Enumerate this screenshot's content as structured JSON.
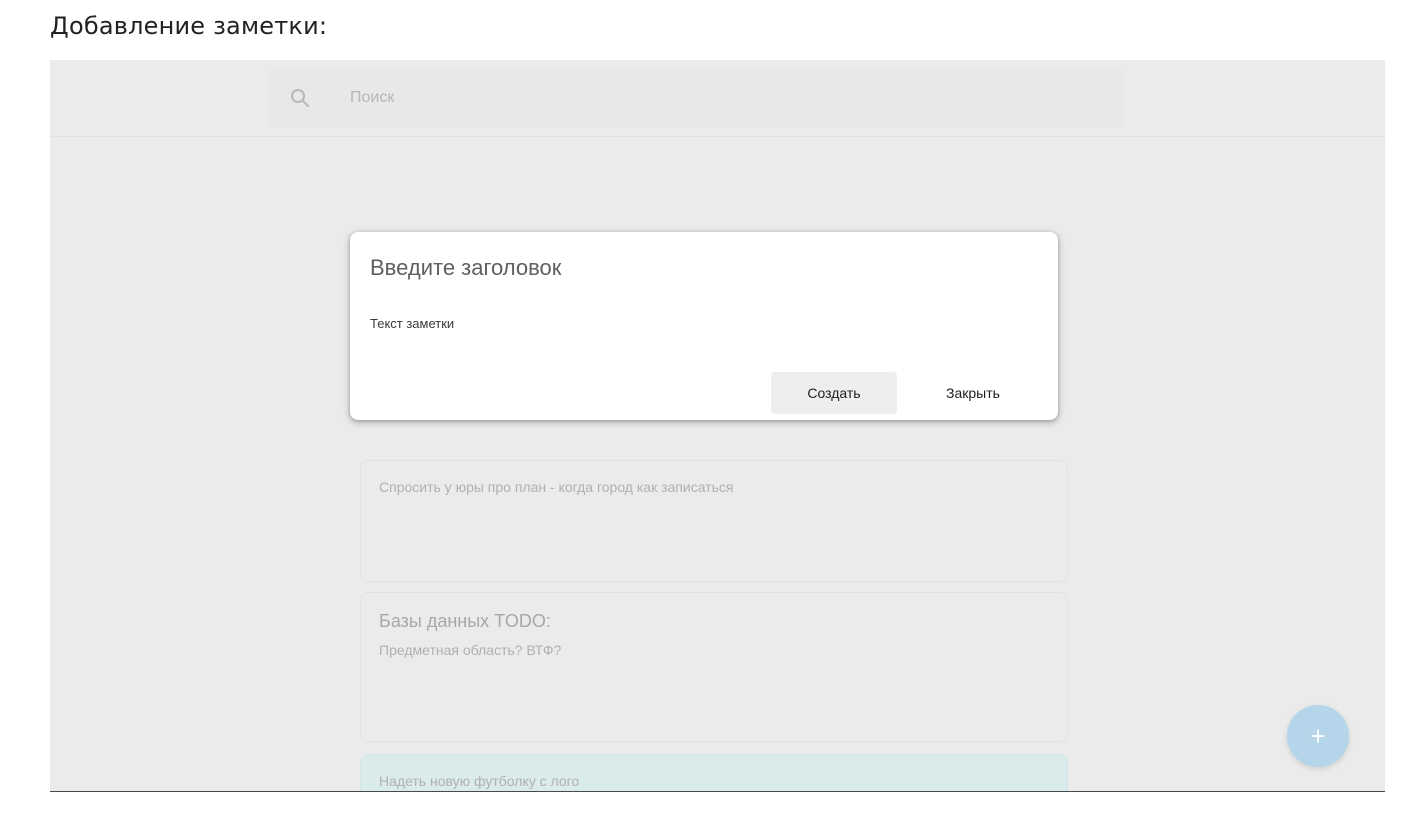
{
  "doc": {
    "heading": "Добавление заметки:"
  },
  "search": {
    "placeholder": "Поиск",
    "icon": "search-icon"
  },
  "dialog": {
    "title_placeholder": "Введите заголовок",
    "text_placeholder": "Текст заметки",
    "create_label": "Создать",
    "close_label": "Закрыть"
  },
  "notes": [
    {
      "title": "",
      "text": "Спросить у юры про план - когда город как записаться",
      "color": "#ebebeb"
    },
    {
      "title": "Базы данных TODO:",
      "text": "Предметная область? ВТФ?",
      "color": "#ebebeb"
    },
    {
      "title": "",
      "text": "Надеть новую футболку с лого",
      "color": "#d9ebea"
    }
  ],
  "fab": {
    "label": "+",
    "icon": "plus-icon",
    "color": "#b4d5ea"
  },
  "colors": {
    "overlay_background": "#ebebeb",
    "dialog_background": "#ffffff"
  }
}
